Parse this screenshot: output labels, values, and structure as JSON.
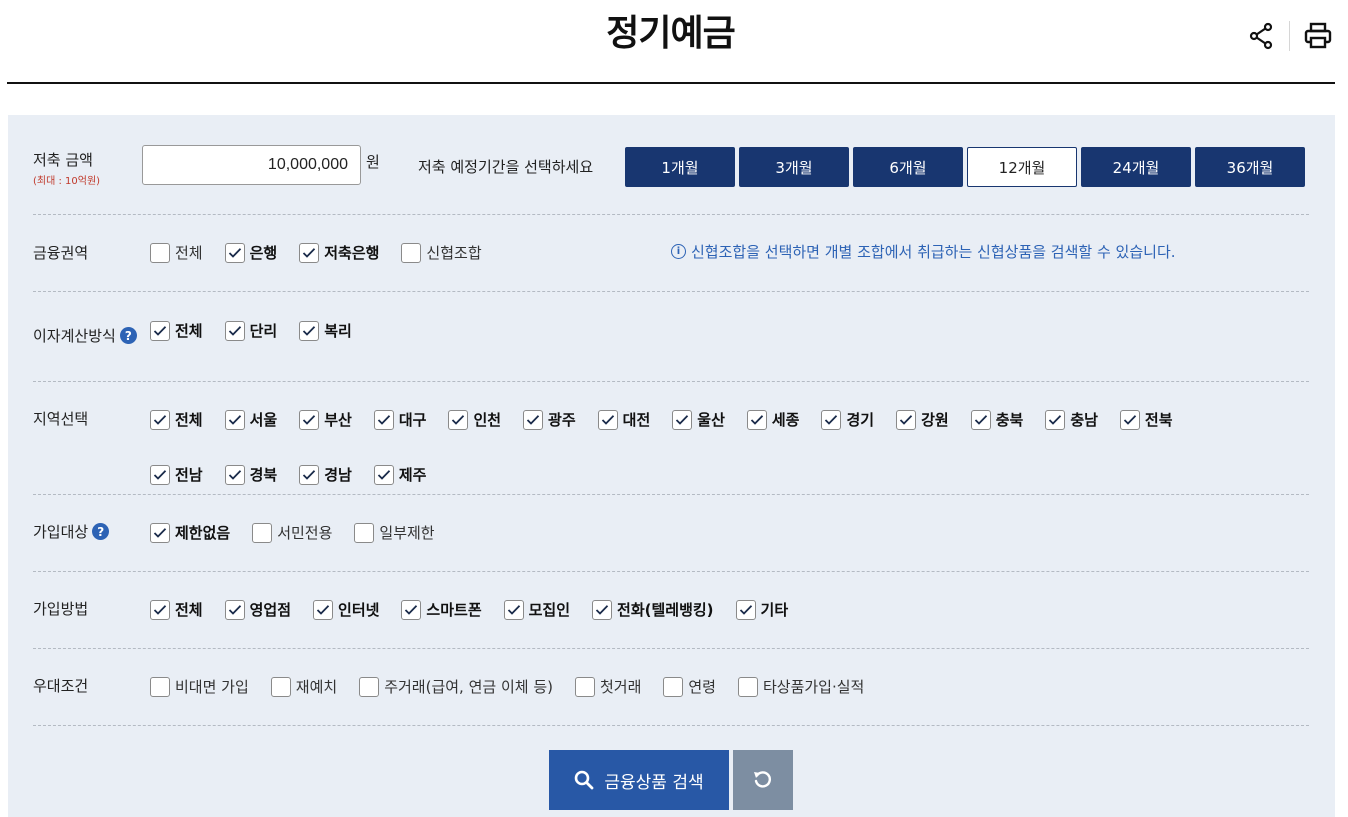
{
  "title": "정기예금",
  "amount": {
    "label": "저축 금액",
    "sublabel": "(최대 : 10억원)",
    "value": "10,000,000",
    "unit": "원"
  },
  "period": {
    "label": "저축 예정기간을 선택하세요",
    "options": [
      "1개월",
      "3개월",
      "6개월",
      "12개월",
      "24개월",
      "36개월"
    ],
    "selected": "12개월"
  },
  "sector": {
    "label": "금융권역",
    "options": [
      {
        "label": "전체",
        "checked": false
      },
      {
        "label": "은행",
        "checked": true
      },
      {
        "label": "저축은행",
        "checked": true
      },
      {
        "label": "신협조합",
        "checked": false
      }
    ],
    "notice": "신협조합을 선택하면 개별 조합에서 취급하는 신협상품을 검색할 수 있습니다."
  },
  "interest": {
    "label": "이자계산방식",
    "options": [
      {
        "label": "전체",
        "checked": true
      },
      {
        "label": "단리",
        "checked": true
      },
      {
        "label": "복리",
        "checked": true
      }
    ]
  },
  "region": {
    "label": "지역선택",
    "options": [
      {
        "label": "전체",
        "checked": true
      },
      {
        "label": "서울",
        "checked": true
      },
      {
        "label": "부산",
        "checked": true
      },
      {
        "label": "대구",
        "checked": true
      },
      {
        "label": "인천",
        "checked": true
      },
      {
        "label": "광주",
        "checked": true
      },
      {
        "label": "대전",
        "checked": true
      },
      {
        "label": "울산",
        "checked": true
      },
      {
        "label": "세종",
        "checked": true
      },
      {
        "label": "경기",
        "checked": true
      },
      {
        "label": "강원",
        "checked": true
      },
      {
        "label": "충북",
        "checked": true
      },
      {
        "label": "충남",
        "checked": true
      },
      {
        "label": "전북",
        "checked": true
      },
      {
        "label": "전남",
        "checked": true
      },
      {
        "label": "경북",
        "checked": true
      },
      {
        "label": "경남",
        "checked": true
      },
      {
        "label": "제주",
        "checked": true
      }
    ]
  },
  "target": {
    "label": "가입대상",
    "options": [
      {
        "label": "제한없음",
        "checked": true
      },
      {
        "label": "서민전용",
        "checked": false
      },
      {
        "label": "일부제한",
        "checked": false
      }
    ]
  },
  "method": {
    "label": "가입방법",
    "options": [
      {
        "label": "전체",
        "checked": true
      },
      {
        "label": "영업점",
        "checked": true
      },
      {
        "label": "인터넷",
        "checked": true
      },
      {
        "label": "스마트폰",
        "checked": true
      },
      {
        "label": "모집인",
        "checked": true
      },
      {
        "label": "전화(텔레뱅킹)",
        "checked": true
      },
      {
        "label": "기타",
        "checked": true
      }
    ]
  },
  "preferential": {
    "label": "우대조건",
    "options": [
      {
        "label": "비대면 가입",
        "checked": false
      },
      {
        "label": "재예치",
        "checked": false
      },
      {
        "label": "주거래(급여, 연금 이체 등)",
        "checked": false
      },
      {
        "label": "첫거래",
        "checked": false
      },
      {
        "label": "연령",
        "checked": false
      },
      {
        "label": "타상품가입·실적",
        "checked": false
      }
    ]
  },
  "search_button": "금융상품 검색",
  "icons": {
    "share": "share-icon",
    "print": "print-icon",
    "help": "question-icon",
    "info": "info-icon",
    "search": "search-icon",
    "reset": "reset-icon",
    "check": "check-icon"
  },
  "colors": {
    "navy": "#183670",
    "primary_blue": "#2858a6",
    "reset_gray": "#7d8ea2",
    "panel_bg": "#e9eef5",
    "notice_blue": "#2d63b5",
    "sublabel_red": "#c0392b"
  }
}
